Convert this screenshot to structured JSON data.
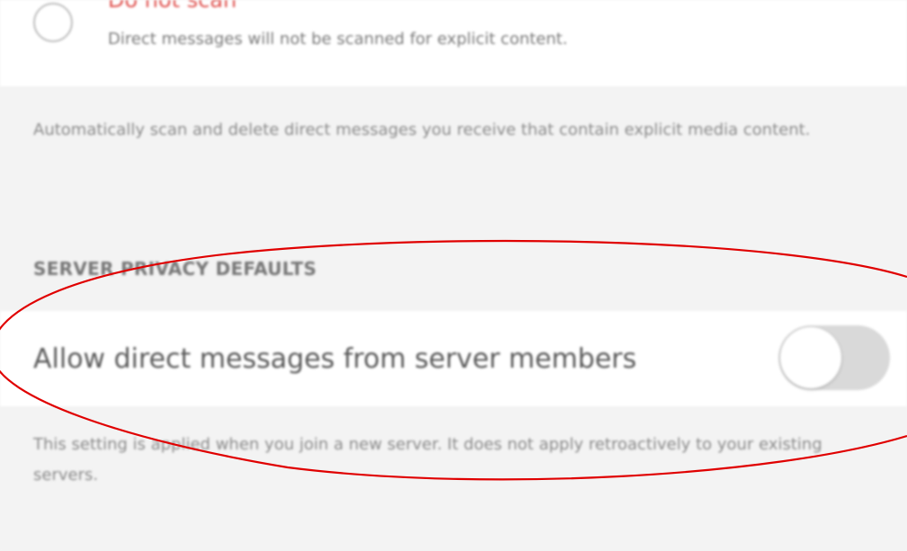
{
  "explicit_filter": {
    "option": {
      "title": "Do not scan",
      "description": "Direct messages will not be scanned for explicit content.",
      "selected": false
    },
    "description": "Automatically scan and delete direct messages you receive that contain explicit media content."
  },
  "server_privacy": {
    "header": "SERVER PRIVACY DEFAULTS",
    "toggle_label": "Allow direct messages from server members",
    "toggle_on": false,
    "description": "This setting is applied when you join a new server. It does not apply retroactively to your existing servers."
  },
  "colors": {
    "option_title": "#e0524f",
    "annotation": "#e00000",
    "background": "#f3f3f3"
  }
}
